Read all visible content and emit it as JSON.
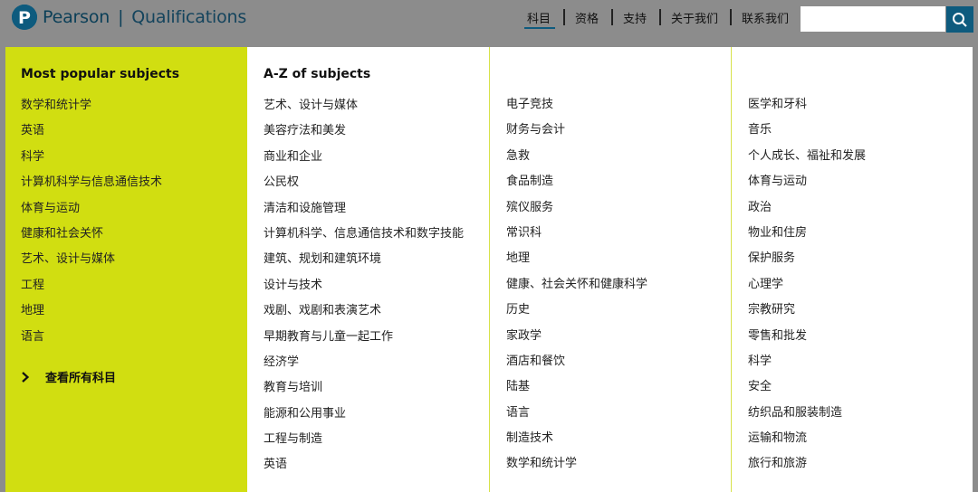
{
  "header": {
    "brand": "Pearson",
    "separator": "|",
    "product": "Qualifications",
    "nav": [
      "科目",
      "资格",
      "支持",
      "关于我们",
      "联系我们"
    ],
    "search": {
      "value": "",
      "placeholder": ""
    },
    "colors": {
      "brand": "#0e5b7e",
      "accent": "#d1de11"
    }
  },
  "popular": {
    "title": "Most popular subjects",
    "items": [
      "数学和统计学",
      "英语",
      "科学",
      "计算机科学与信息通信技术",
      "体育与运动",
      "健康和社会关怀",
      "艺术、设计与媒体",
      "工程",
      "地理",
      "语言"
    ],
    "view_all": "查看所有科目"
  },
  "az": {
    "title": "A-Z of subjects",
    "col1": [
      "艺术、设计与媒体",
      "美容疗法和美发",
      "商业和企业",
      "公民权",
      "清洁和设施管理",
      "计算机科学、信息通信技术和数字技能",
      "建筑、规划和建筑环境",
      "设计与技术",
      "戏剧、戏剧和表演艺术",
      "早期教育与儿童一起工作",
      "经济学",
      "教育与培训",
      "能源和公用事业",
      "工程与制造",
      "英语"
    ],
    "col2": [
      "电子竞技",
      "财务与会计",
      "急救",
      "食品制造",
      "殡仪服务",
      "常识科",
      "地理",
      "健康、社会关怀和健康科学",
      "历史",
      "家政学",
      "酒店和餐饮",
      "陆基",
      "语言",
      "制造技术",
      "数学和统计学"
    ],
    "col3": [
      "医学和牙科",
      "音乐",
      "个人成长、福祉和发展",
      "体育与运动",
      "政治",
      "物业和住房",
      "保护服务",
      "心理学",
      "宗教研究",
      "零售和批发",
      "科学",
      "安全",
      "纺织品和服装制造",
      "运输和物流",
      "旅行和旅游"
    ]
  }
}
